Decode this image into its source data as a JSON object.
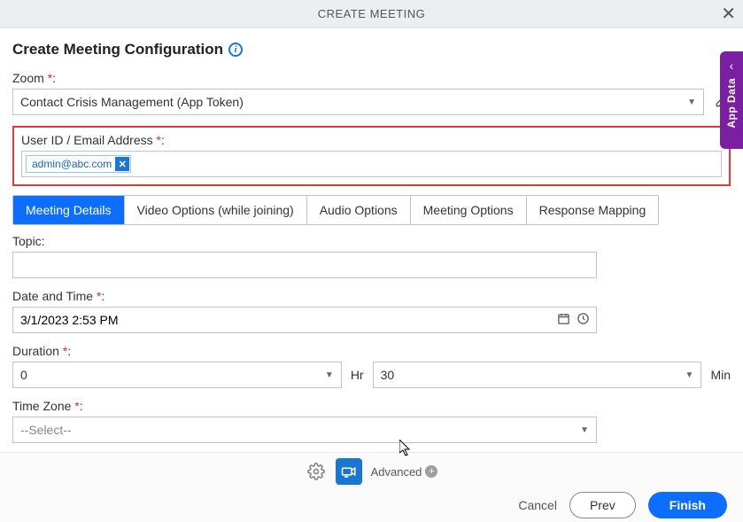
{
  "header": {
    "title": "CREATE MEETING"
  },
  "section_title": "Create Meeting Configuration",
  "zoom": {
    "label": "Zoom ",
    "value": "Contact Crisis Management (App Token)"
  },
  "user_email": {
    "label": "User ID / Email Address ",
    "chip": "admin@abc.com"
  },
  "tabs": [
    {
      "label": "Meeting Details",
      "active": true
    },
    {
      "label": "Video Options (while joining)",
      "active": false
    },
    {
      "label": "Audio Options",
      "active": false
    },
    {
      "label": "Meeting Options",
      "active": false
    },
    {
      "label": "Response Mapping",
      "active": false
    }
  ],
  "topic": {
    "label": "Topic:",
    "value": ""
  },
  "datetime": {
    "label": "Date and Time ",
    "value": "3/1/2023 2:53 PM"
  },
  "duration": {
    "label": "Duration ",
    "hours": "0",
    "hours_unit": "Hr",
    "minutes": "30",
    "minutes_unit": "Min"
  },
  "timezone": {
    "label": "Time Zone ",
    "value": "--Select--"
  },
  "footer": {
    "advanced": "Advanced",
    "cancel": "Cancel",
    "prev": "Prev",
    "finish": "Finish"
  },
  "side_panel": {
    "label": "App Data"
  }
}
